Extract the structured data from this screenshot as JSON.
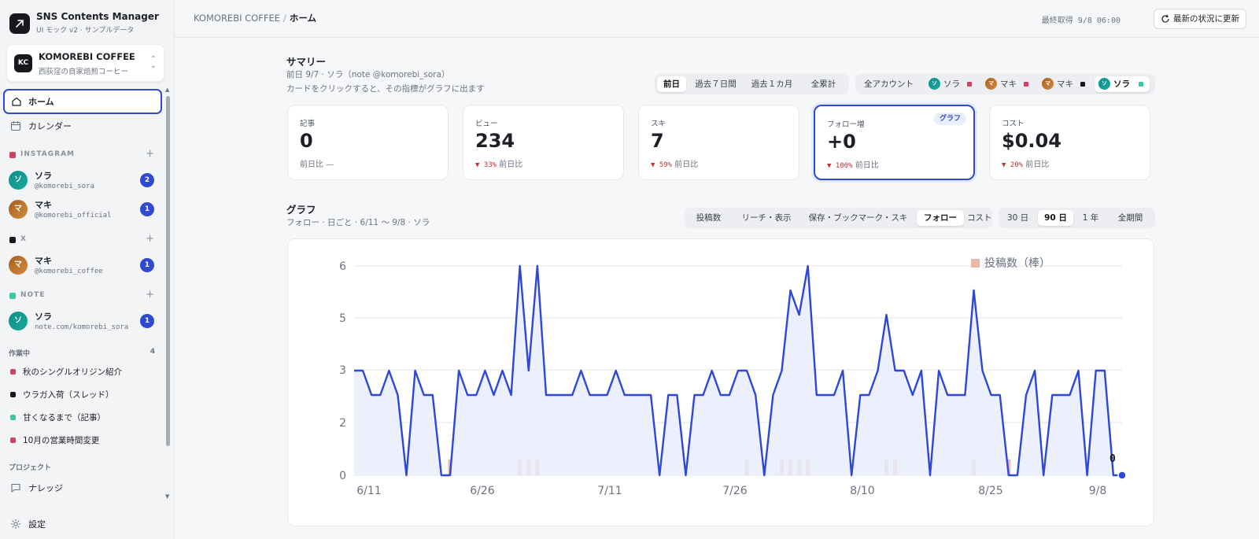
{
  "app": {
    "title": "SNS Contents Manager",
    "subtitle": "UI モック v2 · サンプルデータ"
  },
  "account_switcher": {
    "initials": "KC",
    "name": "KOMOREBI COFFEE",
    "description": "西荻窪の自家焙煎コーヒー"
  },
  "nav": {
    "home": "ホーム",
    "calendar": "カレンダー"
  },
  "sidebar_sections": [
    {
      "label": "INSTAGRAM",
      "color": "#d2405f",
      "accounts": [
        {
          "avatar": "ソ",
          "name": "ソラ",
          "handle": "@komorebi_sora",
          "count": "2"
        },
        {
          "avatar": "マ",
          "name": "マキ",
          "handle": "@komorebi_official",
          "count": "1"
        }
      ]
    },
    {
      "label": "X",
      "color": "#16181d",
      "accounts": [
        {
          "avatar": "マ",
          "name": "マキ",
          "handle": "@komorebi_coffee",
          "count": "1"
        }
      ]
    },
    {
      "label": "NOTE",
      "color": "#3cc6a2",
      "accounts": [
        {
          "avatar": "ソ",
          "name": "ソラ",
          "handle": "note.com/komorebi_sora",
          "count": "1"
        }
      ]
    }
  ],
  "in_progress": {
    "label": "作業中",
    "count": "4",
    "items": [
      {
        "label": "秋のシングルオリジン紹介",
        "color": "#d2405f"
      },
      {
        "label": "ウラガ入荷（スレッド）",
        "color": "#16181d"
      },
      {
        "label": "甘くなるまで（記事）",
        "color": "#3cc6a2"
      },
      {
        "label": "10月の営業時間変更",
        "color": "#d2405f"
      }
    ]
  },
  "projects": {
    "label": "プロジェクト",
    "knowledge": "ナレッジ"
  },
  "settings_label": "設定",
  "topbar": {
    "company": "KOMOREBI COFFEE",
    "separator": "/",
    "page": "ホーム",
    "last_fetch": "最終取得 9/8 06:00",
    "refresh_label": "最新の状況に更新"
  },
  "summary": {
    "title": "サマリー",
    "subtitle": "前日 9/7 · ソラ（note @komorebi_sora）",
    "hint": "カードをクリックすると、その指標がグラフに出ます",
    "periods": [
      "前日",
      "過去７日間",
      "過去１カ月",
      "全累計"
    ],
    "selected_period": "前日",
    "account_filter": {
      "all": "全アカウント",
      "accounts": [
        {
          "avatar": "ソ",
          "name": "ソラ",
          "color": "#d2405f"
        },
        {
          "avatar": "マ",
          "name": "マキ",
          "color": "#d2405f"
        },
        {
          "avatar": "マ",
          "name": "マキ",
          "color": "#16181d"
        },
        {
          "avatar": "ソ",
          "name": "ソラ",
          "color": "#3cc6a2"
        }
      ],
      "selected_index": 3
    },
    "cards": [
      {
        "label": "記事",
        "value": "0",
        "delta_text": "前日比 —",
        "down": ""
      },
      {
        "label": "ビュー",
        "value": "234",
        "delta_text": "前日比",
        "down": "▼ 33%"
      },
      {
        "label": "スキ",
        "value": "7",
        "delta_text": "前日比",
        "down": "▼ 59%"
      },
      {
        "label": "フォロー増",
        "value": "+0",
        "delta_text": "前日比",
        "down": "▼ 100%",
        "tag": "グラフ",
        "selected": true
      },
      {
        "label": "コスト",
        "value": "$0.04",
        "delta_text": "前日比",
        "down": "▼ 20%"
      }
    ]
  },
  "graph": {
    "title": "グラフ",
    "subtitle": "フォロー · 日ごと · 6/11 〜 9/8 · ソラ",
    "metrics": [
      "投稿数",
      "リーチ・表示",
      "保存・ブックマーク・スキ",
      "フォロー",
      "コスト"
    ],
    "selected_metric": "フォロー",
    "ranges": [
      "30 日",
      "90 日",
      "1 年",
      "全期間"
    ],
    "selected_range": "90 日"
  },
  "colors": {
    "accent": "#2f49d1",
    "line": "#2d47d6",
    "area": "#e9ecfb",
    "bar": "#e8b8a8",
    "instagram": "#d2405f",
    "x": "#16181d",
    "note": "#3cc6a2"
  },
  "chart_data": {
    "type": "line",
    "x_tick_labels": [
      "6/11",
      "6/26",
      "7/11",
      "7/26",
      "8/10",
      "8/25",
      "9/8"
    ],
    "y_tick_labels": [
      "0",
      "2",
      "3",
      "5",
      "6"
    ],
    "ylim": [
      0,
      6
    ],
    "legend": "投稿数（棒）",
    "last_value_label": "0",
    "series": [
      {
        "type": "line",
        "values": [
          3,
          3,
          2.3,
          2.3,
          3,
          2.3,
          0,
          3,
          2.3,
          2.3,
          0,
          0,
          3,
          2.3,
          2.3,
          3,
          2.3,
          3,
          2.3,
          6,
          3,
          6,
          2.3,
          2.3,
          2.3,
          2.3,
          3,
          2.3,
          2.3,
          2.3,
          3,
          2.3,
          2.3,
          2.3,
          2.3,
          0,
          2.3,
          2.3,
          0,
          2.3,
          2.3,
          3,
          2.3,
          2.3,
          3,
          3,
          2.3,
          0,
          2.3,
          3,
          5.3,
          4.6,
          6,
          2.3,
          2.3,
          2.3,
          3,
          0,
          2.3,
          2.3,
          3,
          4.6,
          3,
          3,
          2.3,
          3,
          0,
          3,
          2.3,
          2.3,
          2.3,
          5.3,
          3,
          2.3,
          2.3,
          0,
          0,
          2.3,
          3,
          0,
          2.3,
          2.3,
          2.3,
          3,
          0,
          3,
          3,
          0,
          0
        ]
      },
      {
        "type": "bar",
        "values": [
          0,
          0,
          0,
          0,
          0,
          0,
          0,
          0,
          0,
          0,
          0,
          0.45,
          0,
          0,
          0,
          0,
          0,
          0,
          0,
          0.45,
          0.45,
          0.45,
          0,
          0,
          0,
          0,
          0,
          0,
          0,
          0,
          0,
          0,
          0,
          0,
          0,
          0,
          0,
          0,
          0,
          0,
          0,
          0,
          0,
          0,
          0,
          0.45,
          0,
          0,
          0,
          0.45,
          0.45,
          0.45,
          0.45,
          0,
          0,
          0,
          0,
          0,
          0,
          0,
          0,
          0.45,
          0.45,
          0,
          0,
          0,
          0,
          0,
          0,
          0,
          0,
          0.45,
          0,
          0,
          0,
          0.45,
          0,
          0,
          0,
          0,
          0,
          0,
          0,
          0,
          0,
          0,
          0,
          0,
          0
        ]
      }
    ]
  }
}
